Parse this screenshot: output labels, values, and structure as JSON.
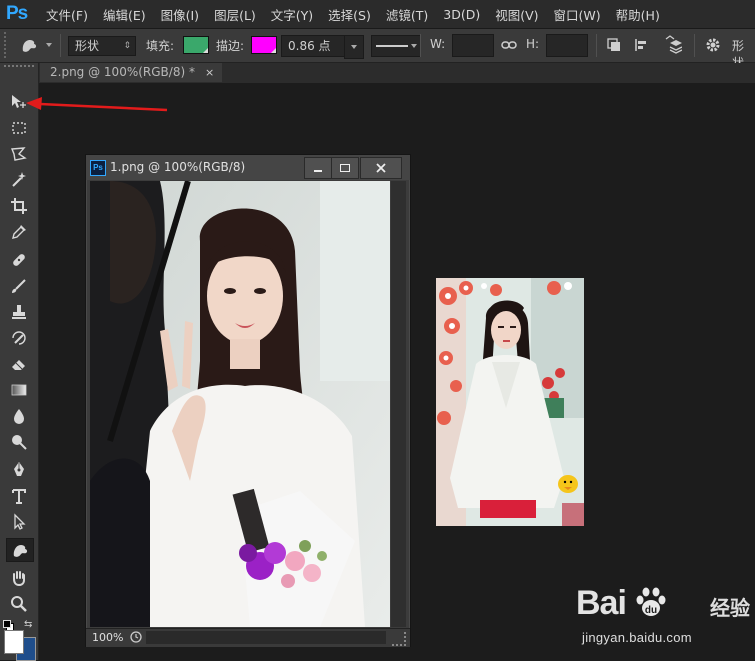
{
  "app": {
    "logo": "Ps",
    "menus": [
      "文件(F)",
      "编辑(E)",
      "图像(I)",
      "图层(L)",
      "文字(Y)",
      "选择(S)",
      "滤镜(T)",
      "3D(D)",
      "视图(V)",
      "窗口(W)",
      "帮助(H)"
    ]
  },
  "options": {
    "mode_value": "形状",
    "fill_label": "填充:",
    "fill_color": "#3aa86b",
    "stroke_label": "描边:",
    "stroke_color": "#ff00ff",
    "stroke_width": "0.86 点",
    "w_label": "W:",
    "h_label": "H:",
    "overflow_label": "形状"
  },
  "tools": [
    {
      "name": "move-tool",
      "active": false
    },
    {
      "name": "marquee-tool",
      "active": false
    },
    {
      "name": "lasso-tool",
      "active": false
    },
    {
      "name": "magic-wand-tool",
      "active": false
    },
    {
      "name": "crop-tool",
      "active": false
    },
    {
      "name": "eyedropper-tool",
      "active": false
    },
    {
      "name": "healing-brush-tool",
      "active": false
    },
    {
      "name": "brush-tool",
      "active": false
    },
    {
      "name": "clone-stamp-tool",
      "active": false
    },
    {
      "name": "history-brush-tool",
      "active": false
    },
    {
      "name": "eraser-tool",
      "active": false
    },
    {
      "name": "gradient-tool",
      "active": false
    },
    {
      "name": "blur-tool",
      "active": false
    },
    {
      "name": "dodge-tool",
      "active": false
    },
    {
      "name": "pen-tool",
      "active": false
    },
    {
      "name": "type-tool",
      "active": false
    },
    {
      "name": "path-selection-tool",
      "active": false
    },
    {
      "name": "custom-shape-tool",
      "active": true
    },
    {
      "name": "hand-tool",
      "active": false
    },
    {
      "name": "zoom-tool",
      "active": false
    }
  ],
  "tab": {
    "title": "2.png @ 100%(RGB/8) *",
    "close": "×"
  },
  "doc_window": {
    "icon": "Ps",
    "title": "1.png @ 100%(RGB/8)",
    "zoom": "100%"
  },
  "colors": {
    "foreground": "#ffffff",
    "background": "#1f4e8c",
    "annotation": "#e21b1b"
  },
  "watermark": {
    "brand": "Bai",
    "brand_suffix": "du",
    "product": "经验",
    "url": "jingyan.baidu.com"
  }
}
